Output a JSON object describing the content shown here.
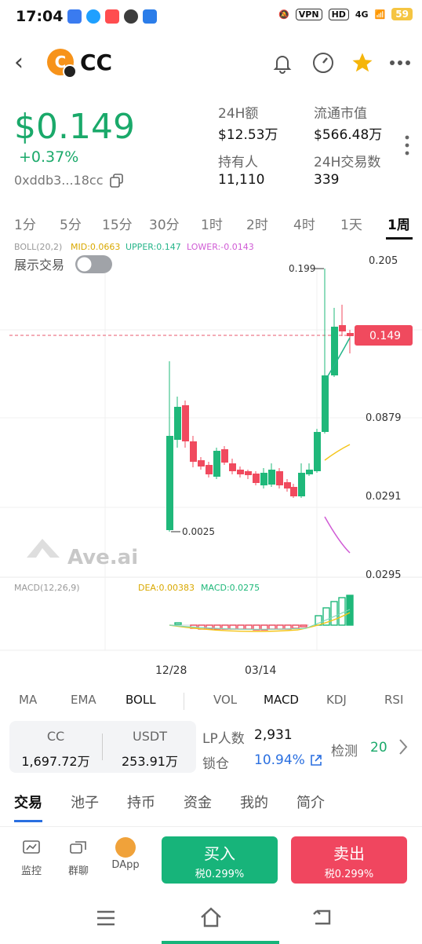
{
  "status": {
    "time": "17:04",
    "vpn": "VPN",
    "hd": "HD",
    "net": "4G",
    "battery": "59"
  },
  "nav": {
    "symbol": "CC",
    "coin_letter": "C"
  },
  "price": {
    "value": "$0.149",
    "change": "+0.37%",
    "address": "0xddb3...18cc"
  },
  "stats": [
    {
      "label": "24H额",
      "value": "$12.53万"
    },
    {
      "label": "流通市值",
      "value": "$566.48万"
    },
    {
      "label": "持有人",
      "value": "11,110"
    },
    {
      "label": "24H交易数",
      "value": "339"
    }
  ],
  "timeframes": [
    "1分",
    "5分",
    "15分",
    "30分",
    "1时",
    "2时",
    "4时",
    "1天",
    "1周"
  ],
  "active_timeframe": "1周",
  "chart": {
    "boll": {
      "label": "BOLL(20,2)",
      "mid": "MID:0.0663",
      "upper": "UPPER:0.147",
      "lower": "LOWER:-0.0143"
    },
    "toggle_label": "展示交易",
    "watermark": "Ave.ai",
    "axis_labels": [
      "0.205",
      "0.0879",
      "0.0291",
      "0.0295"
    ],
    "current_price": "0.149",
    "high_label": "0.199",
    "low_label": "0.0025",
    "macd": {
      "label": "MACD(12,26,9)",
      "dea": "DEA:0.00383",
      "macd": "MACD:0.0275"
    },
    "dates": [
      "12/28",
      "03/14"
    ],
    "colors": {
      "up": "#1fb87a",
      "down": "#f04a5e",
      "mid": "#f5c518",
      "upper": "#26b58a",
      "lower": "#d05bd5"
    }
  },
  "indicators": [
    "MA",
    "EMA",
    "BOLL",
    "VOL",
    "MACD",
    "KDJ",
    "RSI"
  ],
  "active_indicators": [
    "BOLL",
    "MACD"
  ],
  "pair": {
    "base": "CC",
    "base_value": "1,697.72万",
    "quote": "USDT",
    "quote_value": "253.91万"
  },
  "lp": {
    "label": "LP人数",
    "value": "2,931",
    "lock_label": "锁仓",
    "lock_value": "10.94%"
  },
  "detect": {
    "label": "检测",
    "value": "20"
  },
  "tabs": [
    "交易",
    "池子",
    "持币",
    "资金",
    "我的",
    "简介"
  ],
  "active_tab": "交易",
  "bottom": {
    "monitor": "监控",
    "group": "群聊",
    "dapp": "DApp",
    "buy": "买入",
    "buy_tax": "税0.299%",
    "sell": "卖出",
    "sell_tax": "税0.299%"
  }
}
